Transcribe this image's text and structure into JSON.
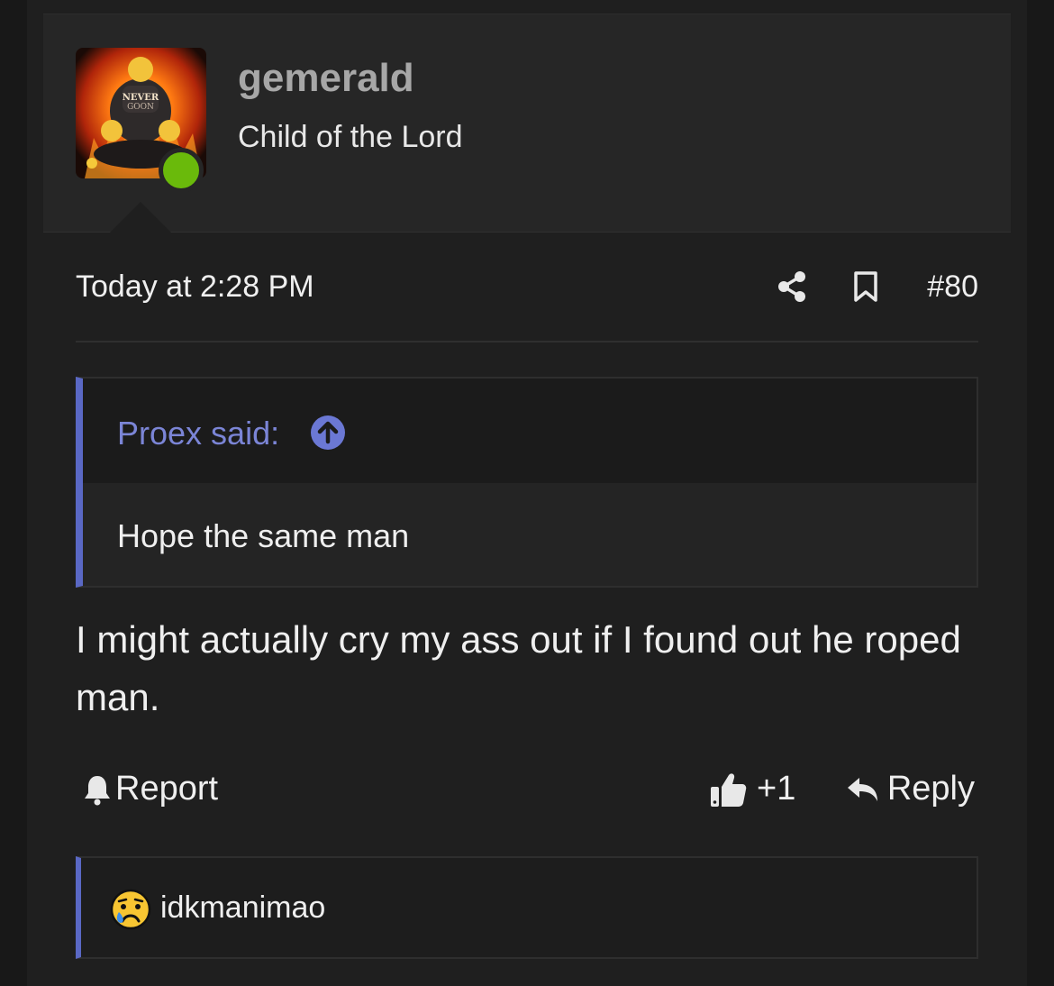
{
  "user": {
    "name": "gemerald",
    "title": "Child of the Lord",
    "avatar_text": "NEVER GOON",
    "online_color": "#6aba0b"
  },
  "post": {
    "time": "Today at 2:28 PM",
    "number": "#80",
    "quote": {
      "author": "Proex said:",
      "text": "Hope the same man"
    },
    "body": "I might actually cry my ass out if I found out he roped man."
  },
  "actions": {
    "report": "Report",
    "like": "+1",
    "reply": "Reply"
  },
  "reactions": {
    "user": "idkmanimao",
    "emoji": "crying-face-icon"
  },
  "colors": {
    "accent": "#5a68c4",
    "quote_author": "#7b85d6",
    "background": "#1f1f1f"
  }
}
